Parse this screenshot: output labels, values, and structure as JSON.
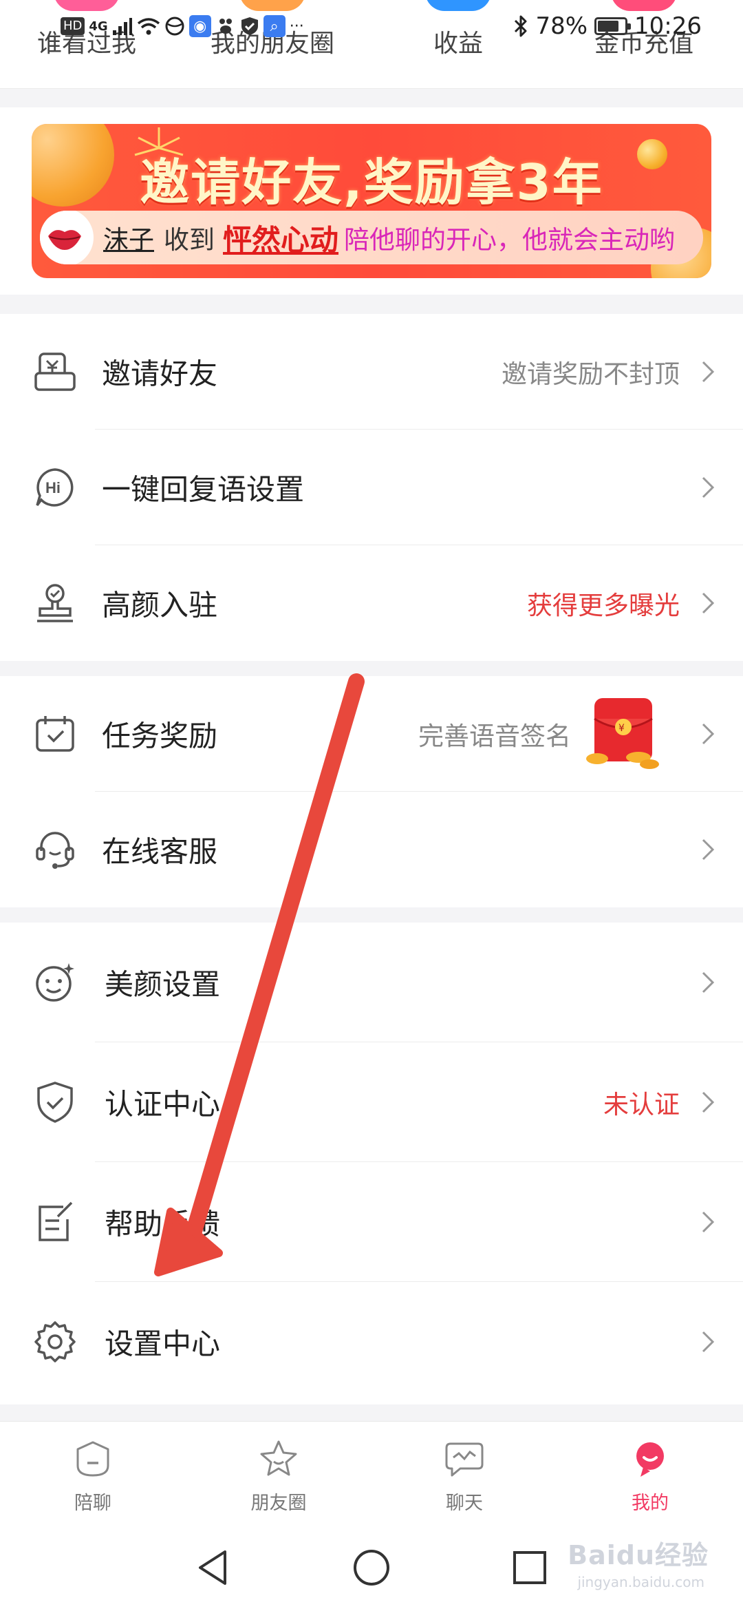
{
  "status_bar": {
    "network": "4G",
    "bluetooth_icon": "bluetooth-icon",
    "battery_percent": 78,
    "battery_text": "78%",
    "time": "10:26"
  },
  "quick_bar": [
    {
      "label": "谁看过我",
      "color": "#ff5e98"
    },
    {
      "label": "我的朋友圈",
      "color": "#ffa24a"
    },
    {
      "label": "收益",
      "color": "#2f95ff"
    },
    {
      "label": "金币充值",
      "color": "#ff4d7a"
    }
  ],
  "banner": {
    "title": "邀请好友,奖励拿3年",
    "ticker": {
      "user": "沫子",
      "verb": "收到",
      "gift": "怦然心动",
      "message": "陪他聊的开心，他就会主动哟"
    }
  },
  "menu_sections": [
    [
      {
        "label": "邀请好友",
        "value": "邀请奖励不封顶",
        "value_color": "#888888",
        "icon": "gift-voucher-icon"
      },
      {
        "label": "一键回复语设置",
        "value": "",
        "icon": "hi-bubble-icon"
      },
      {
        "label": "高颜入驻",
        "value": "获得更多曝光",
        "value_color": "#e43d3d",
        "icon": "stamp-icon"
      }
    ],
    [
      {
        "label": "任务奖励",
        "value": "完善语音签名",
        "value_color": "#888888",
        "icon": "calendar-check-icon",
        "badge_icon": "red-envelope-icon"
      },
      {
        "label": "在线客服",
        "value": "",
        "icon": "headset-icon"
      }
    ],
    [
      {
        "label": "美颜设置",
        "value": "",
        "icon": "beauty-face-icon"
      },
      {
        "label": "认证中心",
        "value": "未认证",
        "value_color": "#e43d3d",
        "icon": "shield-check-icon"
      },
      {
        "label": "帮助反馈",
        "value": "",
        "icon": "feedback-edit-icon"
      },
      {
        "label": "设置中心",
        "value": "",
        "icon": "gear-icon"
      }
    ]
  ],
  "tab_bar": {
    "tabs": [
      {
        "label": "陪聊",
        "icon": "chat-companion-icon",
        "active": false
      },
      {
        "label": "朋友圈",
        "icon": "star-moments-icon",
        "active": false
      },
      {
        "label": "聊天",
        "icon": "message-wave-icon",
        "active": false
      },
      {
        "label": "我的",
        "icon": "profile-me-icon",
        "active": true
      }
    ],
    "active_color": "#f23a63"
  },
  "nav_bar": {
    "buttons": [
      "back-icon",
      "home-icon",
      "recents-icon"
    ]
  },
  "watermark": {
    "text": "Baidu经验",
    "sub": "jingyan.baidu.com"
  },
  "annotation": {
    "arrow_color": "#e8483c",
    "points_to": "设置中心"
  }
}
